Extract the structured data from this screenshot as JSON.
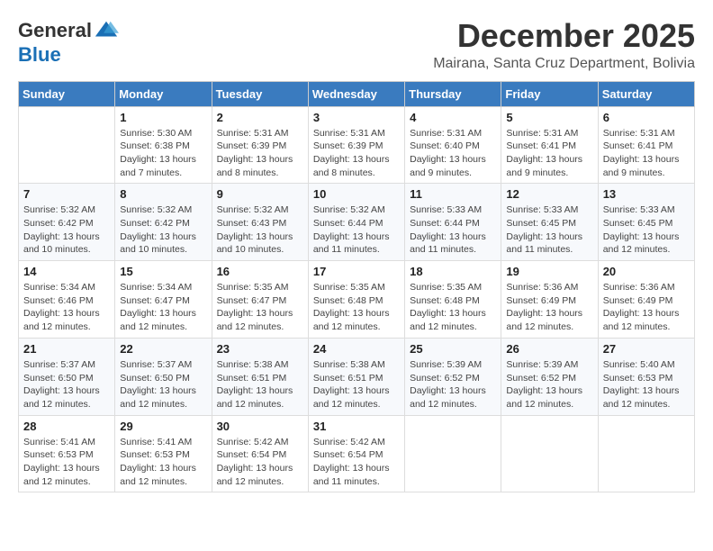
{
  "logo": {
    "general": "General",
    "blue": "Blue"
  },
  "header": {
    "month": "December 2025",
    "location": "Mairana, Santa Cruz Department, Bolivia"
  },
  "days_of_week": [
    "Sunday",
    "Monday",
    "Tuesday",
    "Wednesday",
    "Thursday",
    "Friday",
    "Saturday"
  ],
  "weeks": [
    [
      {
        "day": "",
        "sunrise": "",
        "sunset": "",
        "daylight": ""
      },
      {
        "day": "1",
        "sunrise": "Sunrise: 5:30 AM",
        "sunset": "Sunset: 6:38 PM",
        "daylight": "Daylight: 13 hours and 7 minutes."
      },
      {
        "day": "2",
        "sunrise": "Sunrise: 5:31 AM",
        "sunset": "Sunset: 6:39 PM",
        "daylight": "Daylight: 13 hours and 8 minutes."
      },
      {
        "day": "3",
        "sunrise": "Sunrise: 5:31 AM",
        "sunset": "Sunset: 6:39 PM",
        "daylight": "Daylight: 13 hours and 8 minutes."
      },
      {
        "day": "4",
        "sunrise": "Sunrise: 5:31 AM",
        "sunset": "Sunset: 6:40 PM",
        "daylight": "Daylight: 13 hours and 9 minutes."
      },
      {
        "day": "5",
        "sunrise": "Sunrise: 5:31 AM",
        "sunset": "Sunset: 6:41 PM",
        "daylight": "Daylight: 13 hours and 9 minutes."
      },
      {
        "day": "6",
        "sunrise": "Sunrise: 5:31 AM",
        "sunset": "Sunset: 6:41 PM",
        "daylight": "Daylight: 13 hours and 9 minutes."
      }
    ],
    [
      {
        "day": "7",
        "sunrise": "Sunrise: 5:32 AM",
        "sunset": "Sunset: 6:42 PM",
        "daylight": "Daylight: 13 hours and 10 minutes."
      },
      {
        "day": "8",
        "sunrise": "Sunrise: 5:32 AM",
        "sunset": "Sunset: 6:42 PM",
        "daylight": "Daylight: 13 hours and 10 minutes."
      },
      {
        "day": "9",
        "sunrise": "Sunrise: 5:32 AM",
        "sunset": "Sunset: 6:43 PM",
        "daylight": "Daylight: 13 hours and 10 minutes."
      },
      {
        "day": "10",
        "sunrise": "Sunrise: 5:32 AM",
        "sunset": "Sunset: 6:44 PM",
        "daylight": "Daylight: 13 hours and 11 minutes."
      },
      {
        "day": "11",
        "sunrise": "Sunrise: 5:33 AM",
        "sunset": "Sunset: 6:44 PM",
        "daylight": "Daylight: 13 hours and 11 minutes."
      },
      {
        "day": "12",
        "sunrise": "Sunrise: 5:33 AM",
        "sunset": "Sunset: 6:45 PM",
        "daylight": "Daylight: 13 hours and 11 minutes."
      },
      {
        "day": "13",
        "sunrise": "Sunrise: 5:33 AM",
        "sunset": "Sunset: 6:45 PM",
        "daylight": "Daylight: 13 hours and 12 minutes."
      }
    ],
    [
      {
        "day": "14",
        "sunrise": "Sunrise: 5:34 AM",
        "sunset": "Sunset: 6:46 PM",
        "daylight": "Daylight: 13 hours and 12 minutes."
      },
      {
        "day": "15",
        "sunrise": "Sunrise: 5:34 AM",
        "sunset": "Sunset: 6:47 PM",
        "daylight": "Daylight: 13 hours and 12 minutes."
      },
      {
        "day": "16",
        "sunrise": "Sunrise: 5:35 AM",
        "sunset": "Sunset: 6:47 PM",
        "daylight": "Daylight: 13 hours and 12 minutes."
      },
      {
        "day": "17",
        "sunrise": "Sunrise: 5:35 AM",
        "sunset": "Sunset: 6:48 PM",
        "daylight": "Daylight: 13 hours and 12 minutes."
      },
      {
        "day": "18",
        "sunrise": "Sunrise: 5:35 AM",
        "sunset": "Sunset: 6:48 PM",
        "daylight": "Daylight: 13 hours and 12 minutes."
      },
      {
        "day": "19",
        "sunrise": "Sunrise: 5:36 AM",
        "sunset": "Sunset: 6:49 PM",
        "daylight": "Daylight: 13 hours and 12 minutes."
      },
      {
        "day": "20",
        "sunrise": "Sunrise: 5:36 AM",
        "sunset": "Sunset: 6:49 PM",
        "daylight": "Daylight: 13 hours and 12 minutes."
      }
    ],
    [
      {
        "day": "21",
        "sunrise": "Sunrise: 5:37 AM",
        "sunset": "Sunset: 6:50 PM",
        "daylight": "Daylight: 13 hours and 12 minutes."
      },
      {
        "day": "22",
        "sunrise": "Sunrise: 5:37 AM",
        "sunset": "Sunset: 6:50 PM",
        "daylight": "Daylight: 13 hours and 12 minutes."
      },
      {
        "day": "23",
        "sunrise": "Sunrise: 5:38 AM",
        "sunset": "Sunset: 6:51 PM",
        "daylight": "Daylight: 13 hours and 12 minutes."
      },
      {
        "day": "24",
        "sunrise": "Sunrise: 5:38 AM",
        "sunset": "Sunset: 6:51 PM",
        "daylight": "Daylight: 13 hours and 12 minutes."
      },
      {
        "day": "25",
        "sunrise": "Sunrise: 5:39 AM",
        "sunset": "Sunset: 6:52 PM",
        "daylight": "Daylight: 13 hours and 12 minutes."
      },
      {
        "day": "26",
        "sunrise": "Sunrise: 5:39 AM",
        "sunset": "Sunset: 6:52 PM",
        "daylight": "Daylight: 13 hours and 12 minutes."
      },
      {
        "day": "27",
        "sunrise": "Sunrise: 5:40 AM",
        "sunset": "Sunset: 6:53 PM",
        "daylight": "Daylight: 13 hours and 12 minutes."
      }
    ],
    [
      {
        "day": "28",
        "sunrise": "Sunrise: 5:41 AM",
        "sunset": "Sunset: 6:53 PM",
        "daylight": "Daylight: 13 hours and 12 minutes."
      },
      {
        "day": "29",
        "sunrise": "Sunrise: 5:41 AM",
        "sunset": "Sunset: 6:53 PM",
        "daylight": "Daylight: 13 hours and 12 minutes."
      },
      {
        "day": "30",
        "sunrise": "Sunrise: 5:42 AM",
        "sunset": "Sunset: 6:54 PM",
        "daylight": "Daylight: 13 hours and 12 minutes."
      },
      {
        "day": "31",
        "sunrise": "Sunrise: 5:42 AM",
        "sunset": "Sunset: 6:54 PM",
        "daylight": "Daylight: 13 hours and 11 minutes."
      },
      {
        "day": "",
        "sunrise": "",
        "sunset": "",
        "daylight": ""
      },
      {
        "day": "",
        "sunrise": "",
        "sunset": "",
        "daylight": ""
      },
      {
        "day": "",
        "sunrise": "",
        "sunset": "",
        "daylight": ""
      }
    ]
  ]
}
